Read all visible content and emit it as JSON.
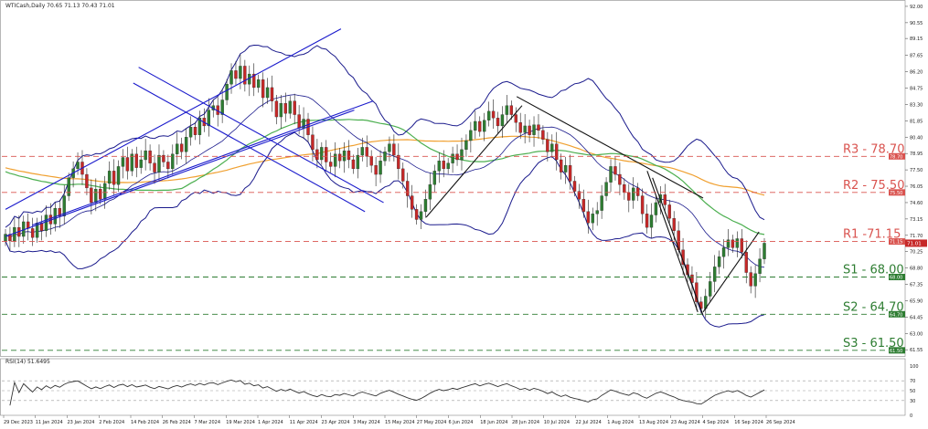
{
  "header": {
    "symbol_info": "WTICash,Daily  70.65 71.13 70.43 71.01",
    "rsi_info": "RSI(14) 51.6495"
  },
  "colors": {
    "bull": "#2e7d32",
    "bear": "#c62828",
    "resistance": "#d9534f",
    "support": "#2e7d32",
    "bollinger": "#1a1a8c",
    "ma_orange": "#f0a030",
    "ma_green": "#4caf50",
    "trendline_blue": "#1a1acc",
    "trendline_black": "#111111",
    "grid": "#d0d0d0"
  },
  "chart_data": [
    {
      "type": "candlestick",
      "title": "WTICash,Daily",
      "ylim": [
        61.0,
        92.4
      ],
      "y_ticks": [
        "92.00",
        "90.55",
        "89.15",
        "87.65",
        "86.20",
        "84.75",
        "83.30",
        "81.85",
        "80.40",
        "78.95",
        "77.50",
        "76.05",
        "74.60",
        "73.15",
        "71.70",
        "70.25",
        "68.80",
        "67.35",
        "65.90",
        "64.45",
        "63.00",
        "61.55"
      ],
      "x_ticks": [
        "29 Dec 2023",
        "11 Jan 2024",
        "23 Jan 2024",
        "2 Feb 2024",
        "14 Feb 2024",
        "26 Feb 2024",
        "7 Mar 2024",
        "19 Mar 2024",
        "1 Apr 2024",
        "11 Apr 2024",
        "23 Apr 2024",
        "3 May 2024",
        "15 May 2024",
        "27 May 2024",
        "6 Jun 2024",
        "18 Jun 2024",
        "28 Jun 2024",
        "10 Jul 2024",
        "22 Jul 2024",
        "1 Aug 2024",
        "13 Aug 2024",
        "23 Aug 2024",
        "4 Sep 2024",
        "16 Sep 2024",
        "26 Sep 2024"
      ],
      "closes": [
        71.8,
        71.2,
        72.4,
        71.6,
        72.9,
        72.3,
        71.5,
        72.8,
        72.1,
        73.5,
        72.7,
        74.1,
        73.4,
        75.2,
        76.8,
        77.6,
        78.2,
        77.1,
        75.9,
        74.6,
        75.8,
        74.9,
        76.3,
        77.4,
        76.2,
        77.8,
        78.6,
        77.4,
        78.9,
        77.7,
        78.4,
        79.2,
        78.1,
        77.3,
        78.8,
        78.2,
        77.6,
        78.9,
        79.8,
        79.1,
        80.4,
        81.3,
        80.6,
        82.1,
        81.4,
        82.8,
        83.2,
        82.4,
        83.7,
        85.1,
        86.3,
        85.6,
        86.7,
        85.1,
        86.0,
        84.8,
        85.5,
        83.9,
        84.8,
        83.6,
        82.2,
        83.4,
        82.5,
        83.6,
        82.4,
        81.2,
        82.0,
        80.6,
        79.3,
        78.4,
        79.5,
        78.2,
        77.8,
        78.9,
        78.3,
        79.2,
        78.4,
        77.6,
        78.8,
        79.5,
        78.7,
        77.9,
        77.1,
        78.3,
        79.1,
        79.8,
        78.8,
        77.6,
        76.5,
        75.2,
        74.0,
        73.1,
        73.8,
        74.9,
        76.2,
        77.4,
        78.3,
        77.6,
        78.1,
        78.9,
        78.4,
        79.3,
        80.1,
        81.0,
        81.8,
        80.9,
        81.9,
        82.7,
        82.1,
        81.4,
        82.4,
        83.2,
        82.4,
        81.7,
        80.8,
        81.4,
        80.6,
        81.5,
        81.0,
        80.2,
        79.1,
        79.8,
        78.4,
        77.3,
        77.9,
        76.5,
        75.6,
        74.9,
        73.8,
        72.8,
        73.6,
        73.9,
        75.2,
        76.4,
        77.8,
        77.1,
        76.2,
        75.5,
        74.8,
        75.9,
        75.2,
        73.6,
        72.4,
        73.5,
        74.6,
        75.3,
        74.4,
        73.2,
        72.1,
        70.4,
        69.1,
        68.2,
        67.5,
        65.8,
        65.2,
        66.3,
        67.6,
        68.9,
        69.8,
        70.6,
        71.3,
        70.6,
        71.4,
        70.2,
        68.4,
        67.2,
        68.3,
        69.6,
        71.0
      ],
      "open_first": 71.2,
      "x_range": [
        "29 Dec 2023",
        "30 Sep 2024"
      ],
      "levels": [
        {
          "label": "R3 - 78.70",
          "value": 78.7,
          "kind": "resistance",
          "badge": "78.70"
        },
        {
          "label": "R2 - 75.50",
          "value": 75.5,
          "kind": "resistance",
          "badge": "75.50"
        },
        {
          "label": "R1 -71.15",
          "value": 71.15,
          "kind": "resistance",
          "badge": "71.15"
        },
        {
          "label": "S1 - 68.00",
          "value": 68.0,
          "kind": "support",
          "badge": "68.00"
        },
        {
          "label": "S2 - 64.70",
          "value": 64.7,
          "kind": "support",
          "badge": "64.70"
        },
        {
          "label": "S3 - 61.50",
          "value": 61.5,
          "kind": "support",
          "badge": "61.50"
        }
      ],
      "price_badge": "71.01",
      "indicators": [
        "Bollinger Bands",
        "Moving Average",
        "Moving Average"
      ],
      "grid": false
    },
    {
      "type": "line",
      "title": "RSI(14) 51.6495",
      "ylim": [
        0,
        100
      ],
      "y_ticks": [
        "100",
        "70",
        "50",
        "30",
        "0"
      ],
      "levels": [
        70,
        50,
        30
      ],
      "last_value": 51.6495
    }
  ]
}
